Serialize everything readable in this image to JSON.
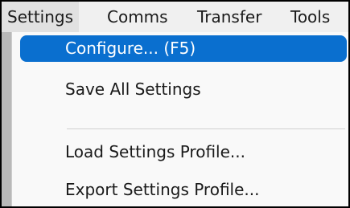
{
  "menubar": {
    "items": [
      {
        "label": "Settings",
        "active": true
      },
      {
        "label": "Comms"
      },
      {
        "label": "Transfer"
      },
      {
        "label": "Tools"
      }
    ]
  },
  "settings_menu": {
    "items": [
      {
        "label": "Configure... (F5)",
        "highlighted": true
      },
      {
        "label": "Save All Settings"
      },
      {
        "label": "Load Settings Profile..."
      },
      {
        "label": "Export Settings Profile..."
      }
    ]
  },
  "colors": {
    "highlight": "#0a6fcf",
    "menubar_bg": "#f0f0f0",
    "menu_bg": "#f9f9f9"
  }
}
